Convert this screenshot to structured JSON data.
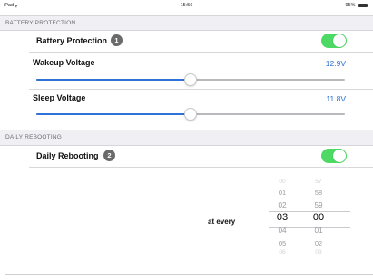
{
  "status_bar": {
    "carrier": "iPad",
    "time": "15:56",
    "battery": "95%"
  },
  "battery_protection": {
    "header": "BATTERY PROTECTION",
    "toggle_label": "Battery Protection",
    "badge": "1",
    "toggle_on": true,
    "wakeup": {
      "label": "Wakeup Voltage",
      "value": "12.9V",
      "slider_fraction": 0.5
    },
    "sleep": {
      "label": "Sleep Voltage",
      "value": "11.8V",
      "slider_fraction": 0.5
    }
  },
  "daily_rebooting": {
    "header": "DAILY REBOOTING",
    "toggle_label": "Daily Rebooting",
    "badge": "2",
    "toggle_on": true,
    "picker_label": "at every",
    "hours": [
      "00",
      "01",
      "02",
      "03",
      "04",
      "05",
      "06"
    ],
    "minutes": [
      "57",
      "58",
      "59",
      "00",
      "01",
      "02",
      "03"
    ],
    "selected_hour": "03",
    "selected_minute": "00"
  },
  "colors": {
    "accent": "#2f73d9",
    "toggle_on": "#4cd964",
    "value_text": "#2a6fd6"
  }
}
